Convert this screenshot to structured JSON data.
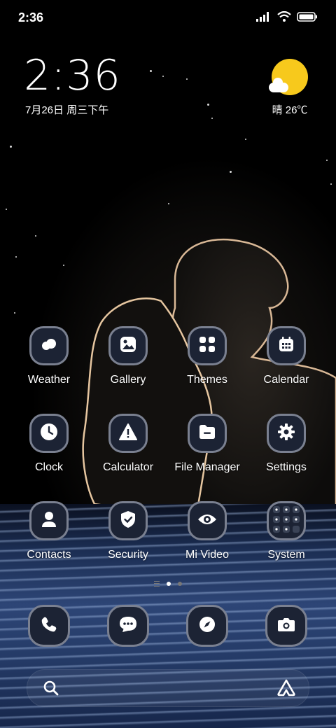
{
  "status_bar": {
    "time": "2:36",
    "icons": [
      "signal-icon",
      "wifi-icon",
      "battery-icon"
    ]
  },
  "clock_widget": {
    "time": "2:36",
    "date": "7月26日 周三下午"
  },
  "weather_widget": {
    "icon": "partly-sunny-icon",
    "text": "晴 26℃",
    "sun_color": "#f7c91c"
  },
  "apps": [
    {
      "label": "Weather",
      "icon": "weather-icon"
    },
    {
      "label": "Gallery",
      "icon": "gallery-icon"
    },
    {
      "label": "Themes",
      "icon": "themes-icon"
    },
    {
      "label": "Calendar",
      "icon": "calendar-icon"
    },
    {
      "label": "Clock",
      "icon": "clock-icon"
    },
    {
      "label": "Calculator",
      "icon": "calculator-icon"
    },
    {
      "label": "File Manager",
      "icon": "file-manager-icon"
    },
    {
      "label": "Settings",
      "icon": "settings-icon"
    },
    {
      "label": "Contacts",
      "icon": "contacts-icon"
    },
    {
      "label": "Security",
      "icon": "security-icon"
    },
    {
      "label": "Mi Video",
      "icon": "video-icon"
    },
    {
      "label": "System",
      "icon": "system-folder-icon"
    }
  ],
  "page_indicator": {
    "pages": 2,
    "active": 1
  },
  "dock": [
    {
      "icon": "phone-icon"
    },
    {
      "icon": "messages-icon"
    },
    {
      "icon": "browser-icon"
    },
    {
      "icon": "camera-icon"
    }
  ],
  "search_bar": {
    "left_icon": "search-icon",
    "right_icon": "assistant-icon"
  },
  "colors": {
    "tile_bg": "#1c2334",
    "tile_border": "#7a8090",
    "water": "#2d4576"
  }
}
